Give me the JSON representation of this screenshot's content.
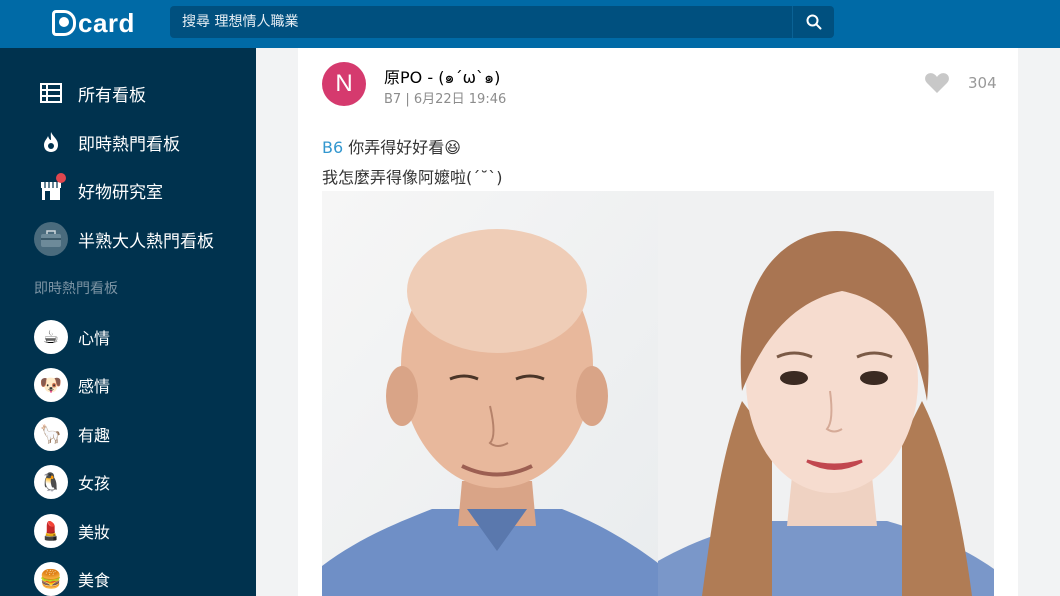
{
  "header": {
    "logo_text": "card",
    "search_placeholder": "搜尋 理想情人職業"
  },
  "sidebar": {
    "nav": [
      {
        "label": "所有看板",
        "icon": "list-icon"
      },
      {
        "label": "即時熱門看板",
        "icon": "flame-icon"
      },
      {
        "label": "好物研究室",
        "icon": "store-icon"
      },
      {
        "label": "半熟大人熱門看板",
        "icon": "briefcase-icon"
      }
    ],
    "section_title": "即時熱門看板",
    "boards": [
      {
        "label": "心情",
        "emoji": "☕"
      },
      {
        "label": "感情",
        "emoji": "🐶"
      },
      {
        "label": "有趣",
        "emoji": "🦙"
      },
      {
        "label": "女孩",
        "emoji": "🐧"
      },
      {
        "label": "美妝",
        "emoji": "💄"
      },
      {
        "label": "美食",
        "emoji": "🍔"
      }
    ]
  },
  "post": {
    "avatar_letter": "N",
    "author": "原PO - (๑´ω`๑)",
    "meta": "B7 | 6月22日 19:46",
    "likes": "304",
    "floor_ref": "B6",
    "line1_text": " 你弄得好好看😆",
    "line2_text": "我怎麼弄得像阿嬤啦(ˊ˘ˋ)"
  },
  "colors": {
    "header": "#006aa6",
    "sidebar": "#00324e",
    "avatar": "#d53a6e",
    "link": "#3397cf"
  }
}
